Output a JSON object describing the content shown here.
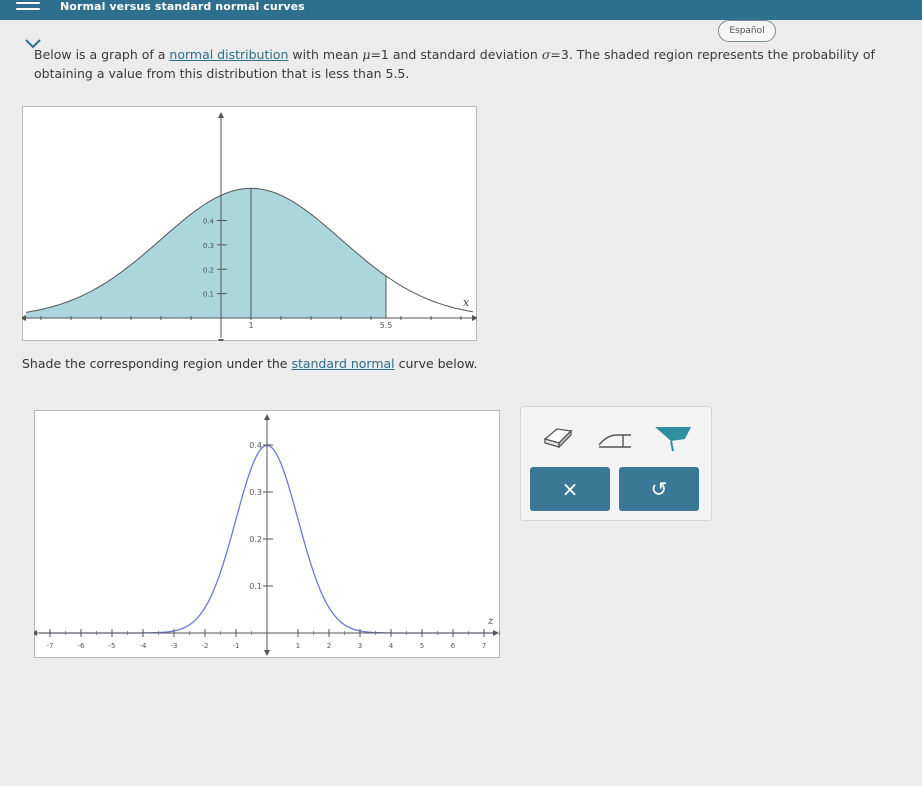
{
  "header": {
    "title": "Normal versus standard normal curves"
  },
  "language_button": {
    "label": "Español"
  },
  "problem": {
    "part1": "Below is a graph of a ",
    "link1": "normal distribution",
    "part2": " with mean ",
    "mu_sym": "μ",
    "mu_val": "=1",
    "part3": " and standard deviation ",
    "sigma_sym": "σ",
    "sigma_val": "=3",
    "part4": ". The shaded region represents the probability of obtaining a value from this distribution that is less than 5.5."
  },
  "instruction": {
    "part1": "Shade the corresponding region under the ",
    "link": "standard normal",
    "part2": " curve below."
  },
  "graph1": {
    "y_ticks": [
      "0.4",
      "0.3",
      "0.2",
      "0.1"
    ],
    "x_tick_mean": "1",
    "x_tick_cutoff": "5.5",
    "x_axis_label": "x",
    "fill_color": "#aad6dc"
  },
  "graph2": {
    "y_ticks": [
      "0.4",
      "0.3",
      "0.2",
      "0.1"
    ],
    "x_ticks": [
      "-7",
      "-6",
      "-5",
      "-4",
      "-3",
      "-2",
      "-1",
      "1",
      "2",
      "3",
      "4",
      "5",
      "6",
      "7"
    ],
    "x_axis_label": "z",
    "curve_color": "#6a78d8"
  },
  "toolbar": {
    "tools": [
      "eraser-icon",
      "horizontal-segment-icon",
      "fill-region-icon"
    ],
    "clear_label": "×",
    "undo_label": "↺"
  },
  "colors": {
    "header_bg": "#2e6f8d",
    "button_bg": "#3a7896",
    "link": "#2b6f8d"
  }
}
